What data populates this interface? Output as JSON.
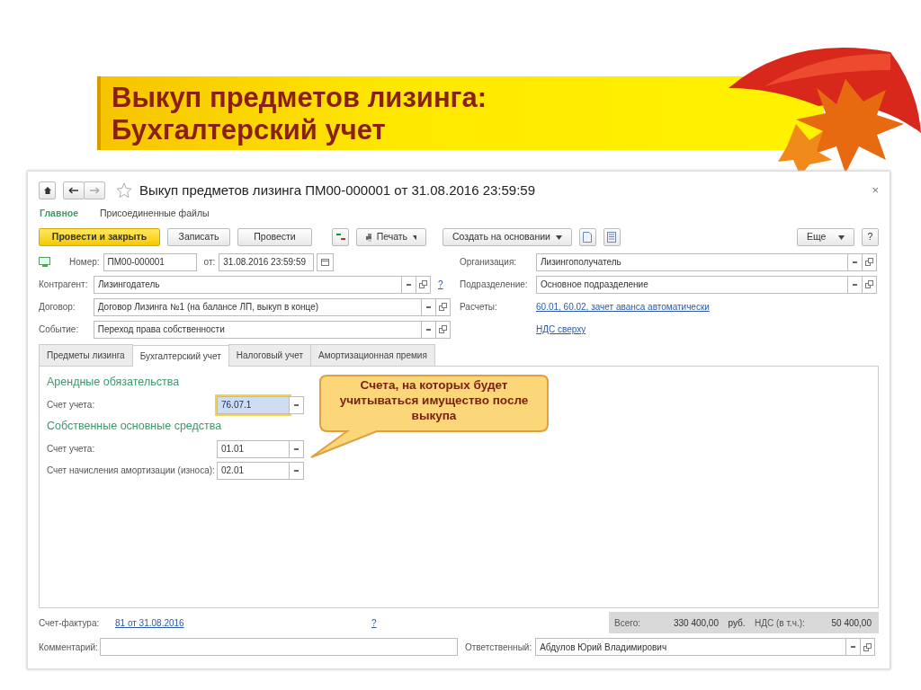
{
  "slide": {
    "title_lines": [
      "Выкуп предметов лизинга:",
      "Бухгалтерский учет"
    ]
  },
  "window": {
    "title": "Выкуп предметов лизинга ПМ00-000001 от 31.08.2016 23:59:59",
    "close": "×"
  },
  "nav_tabs": [
    {
      "label": "Главное",
      "selected": true
    },
    {
      "label": "Присоединенные файлы",
      "selected": false
    }
  ],
  "toolbar": {
    "left": [
      {
        "kind": "primary",
        "label": "Провести и закрыть"
      },
      {
        "kind": "button",
        "label": "Записать"
      },
      {
        "kind": "button",
        "label": "Провести"
      },
      {
        "kind": "ledger"
      },
      {
        "kind": "print",
        "label": "Печать"
      },
      {
        "kind": "dropdown",
        "label": "Создать на основании"
      },
      {
        "kind": "document"
      },
      {
        "kind": "report"
      }
    ],
    "right": [
      {
        "kind": "dropdown",
        "label": "Еще"
      },
      {
        "kind": "button",
        "label": "?"
      }
    ]
  },
  "header": {
    "number_label": "Номер:",
    "number": "ПМ00-000001",
    "date_label": "от:",
    "date": "31.08.2016 23:59:59"
  },
  "left_fields": [
    {
      "label": "Контрагент:",
      "value": "Лизингодатель",
      "help": "?"
    },
    {
      "label": "Договор:",
      "value": "Договор Лизинга №1 (на балансе ЛП, выкуп в конце)"
    },
    {
      "label": "Событие:",
      "value": "Переход права собственности"
    }
  ],
  "right_fields": [
    {
      "kind": "field",
      "label": "Организация:",
      "value": "Лизингополучатель"
    },
    {
      "kind": "field",
      "label": "Подразделение:",
      "value": "Основное подразделение"
    },
    {
      "kind": "link",
      "label": "Расчеты:",
      "value": "60.01, 60.02, зачет аванса автоматически"
    },
    {
      "kind": "link",
      "value": "НДС сверху"
    }
  ],
  "tabs": [
    {
      "label": "Предметы лизинга",
      "selected": false
    },
    {
      "label": "Бухгалтерский учет",
      "selected": true
    },
    {
      "label": "Налоговый учет",
      "selected": false
    },
    {
      "label": "Амортизационная премия",
      "selected": false
    }
  ],
  "groups": [
    {
      "heading": "Арендные обязательства",
      "fields": [
        {
          "label": "Счет учета:",
          "value": "76.07.1",
          "focused": true
        }
      ]
    },
    {
      "heading": "Собственные основные средства",
      "fields": [
        {
          "label": "Счет учета:",
          "value": "01.01",
          "focused": false
        },
        {
          "label": "Счет начисления амортизации (износа):",
          "value": "02.01",
          "focused": false
        }
      ]
    }
  ],
  "callout": {
    "text": "Счета, на которых будет учитываться имущество после выкупа"
  },
  "footer": {
    "invoice_label": "Счет-фактура:",
    "invoice_link": "81 от 31.08.2016",
    "help": "?",
    "total_label": "Всего:",
    "total": "330 400,00",
    "currency": "руб.",
    "vat_label": "НДС (в т.ч.):",
    "vat": "50 400,00",
    "comment_label": "Комментарий:",
    "responsible_label": "Ответственный:",
    "responsible": "Абдулов Юрий Владимирович"
  }
}
